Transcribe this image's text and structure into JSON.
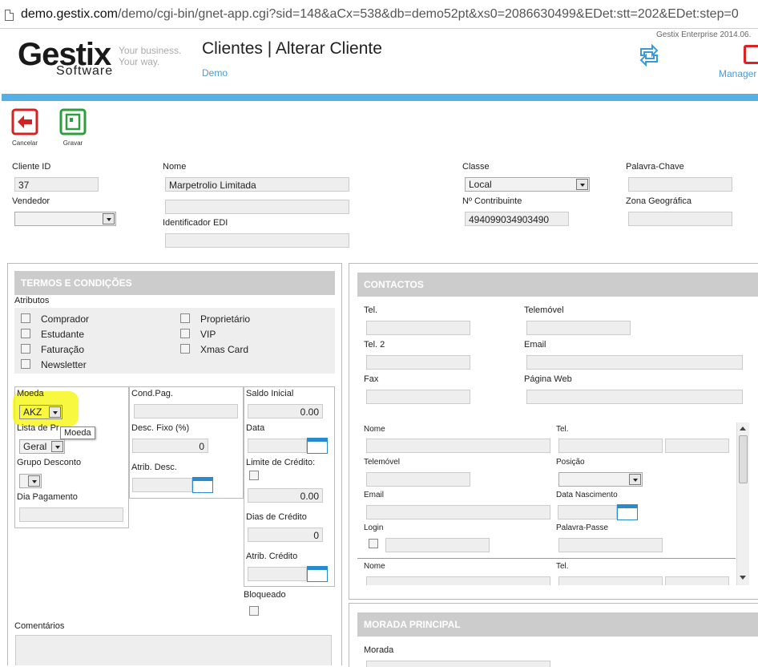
{
  "browser": {
    "url_host": "demo.gestix.com",
    "url_path": "/demo/cgi-bin/gnet-app.cgi?sid=148&aCx=538&db=demo52pt&xs0=2086630499&EDet:stt=202&EDet:step=0"
  },
  "header": {
    "logo_main": "Gestix",
    "logo_sub": "Software",
    "tagline_1": "Your business.",
    "tagline_2": "Your way.",
    "title": "Clientes | Alterar Cliente",
    "demo_link": "Demo",
    "enterprise": "Gestix Enterprise 2014.06.",
    "manager": "Manager"
  },
  "colors": {
    "accent": "#55b1e5",
    "link": "#4a9bd6",
    "cancel": "#d22222",
    "save": "#2e9e3a",
    "highlight": "#f5f500"
  },
  "toolbar": {
    "cancel_label": "Cancelar",
    "save_label": "Gravar"
  },
  "top_form": {
    "cliente_id_label": "Cliente ID",
    "cliente_id": "37",
    "vendedor_label": "Vendedor",
    "vendedor": "",
    "nome_label": "Nome",
    "nome": "Marpetrolio Limitada",
    "nome2": "",
    "edi_label": "Identificador EDI",
    "edi": "",
    "classe_label": "Classe",
    "classe": "Local",
    "contribuinte_label": "Nº Contribuinte",
    "contribuinte": "494099034903490",
    "palavra_chave_label": "Palavra-Chave",
    "palavra_chave": "",
    "zona_label": "Zona Geográfica",
    "zona": ""
  },
  "termos": {
    "title": "TERMOS E CONDIÇÕES",
    "atributos_label": "Atributos",
    "atributos_left": [
      "Comprador",
      "Estudante",
      "Faturação",
      "Newsletter"
    ],
    "atributos_right": [
      "Proprietário",
      "VIP",
      "Xmas Card"
    ],
    "moeda_label": "Moeda",
    "moeda": "AKZ",
    "moeda_tooltip": "Moeda",
    "lista_label": "Lista de Pr",
    "lista": "Geral",
    "grupo_label": "Grupo Desconto",
    "grupo": "",
    "dia_label": "Dia Pagamento",
    "dia": "",
    "cond_label": "Cond.Pag.",
    "cond": "",
    "desc_fixo_label": "Desc. Fixo (%)",
    "desc_fixo": "0",
    "atrib_desc_label": "Atrib. Desc.",
    "saldo_label": "Saldo Inicial",
    "saldo": "0.00",
    "data_label": "Data",
    "limite_label": "Limite de Crédito:",
    "limite": "0.00",
    "dias_label": "Dias de Crédito",
    "dias": "0",
    "atrib_credito_label": "Atrib. Crédito",
    "bloqueado_label": "Bloqueado",
    "comentarios_label": "Comentários"
  },
  "contactos": {
    "title": "CONTACTOS",
    "tel_label": "Tel.",
    "telemovel_label": "Telemóvel",
    "tel2_label": "Tel. 2",
    "email_label": "Email",
    "fax_label": "Fax",
    "pagina_label": "Página Web",
    "pessoa": {
      "nome_label": "Nome",
      "tel_label": "Tel.",
      "telemovel_label": "Telemóvel",
      "posicao_label": "Posição",
      "email_label": "Email",
      "nascimento_label": "Data Nascimento",
      "login_label": "Login",
      "palavra_passe_label": "Palavra-Passe"
    },
    "pessoa2": {
      "nome_label": "Nome",
      "tel_label": "Tel."
    }
  },
  "morada": {
    "title": "MORADA PRINCIPAL",
    "morada_label": "Morada"
  }
}
